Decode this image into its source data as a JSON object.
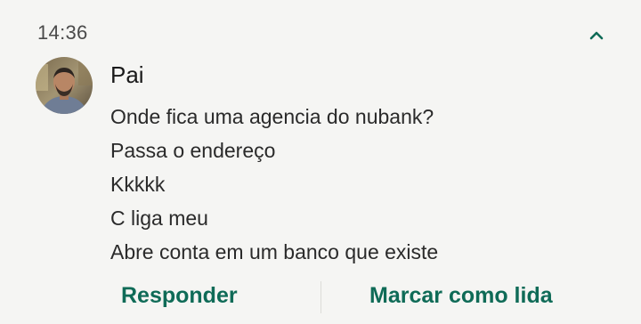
{
  "header": {
    "time": "14:36",
    "collapse_icon": "chevron-up-icon",
    "accent_color": "#0f6b57"
  },
  "conversation": {
    "sender": "Pai",
    "avatar_icon": "contact-photo",
    "messages": [
      "Onde fica uma agencia do nubank?",
      "Passa o endereço",
      "Kkkkk",
      "C liga meu",
      "Abre conta em um banco que existe"
    ]
  },
  "actions": {
    "reply_label": "Responder",
    "mark_read_label": "Marcar como lida"
  }
}
